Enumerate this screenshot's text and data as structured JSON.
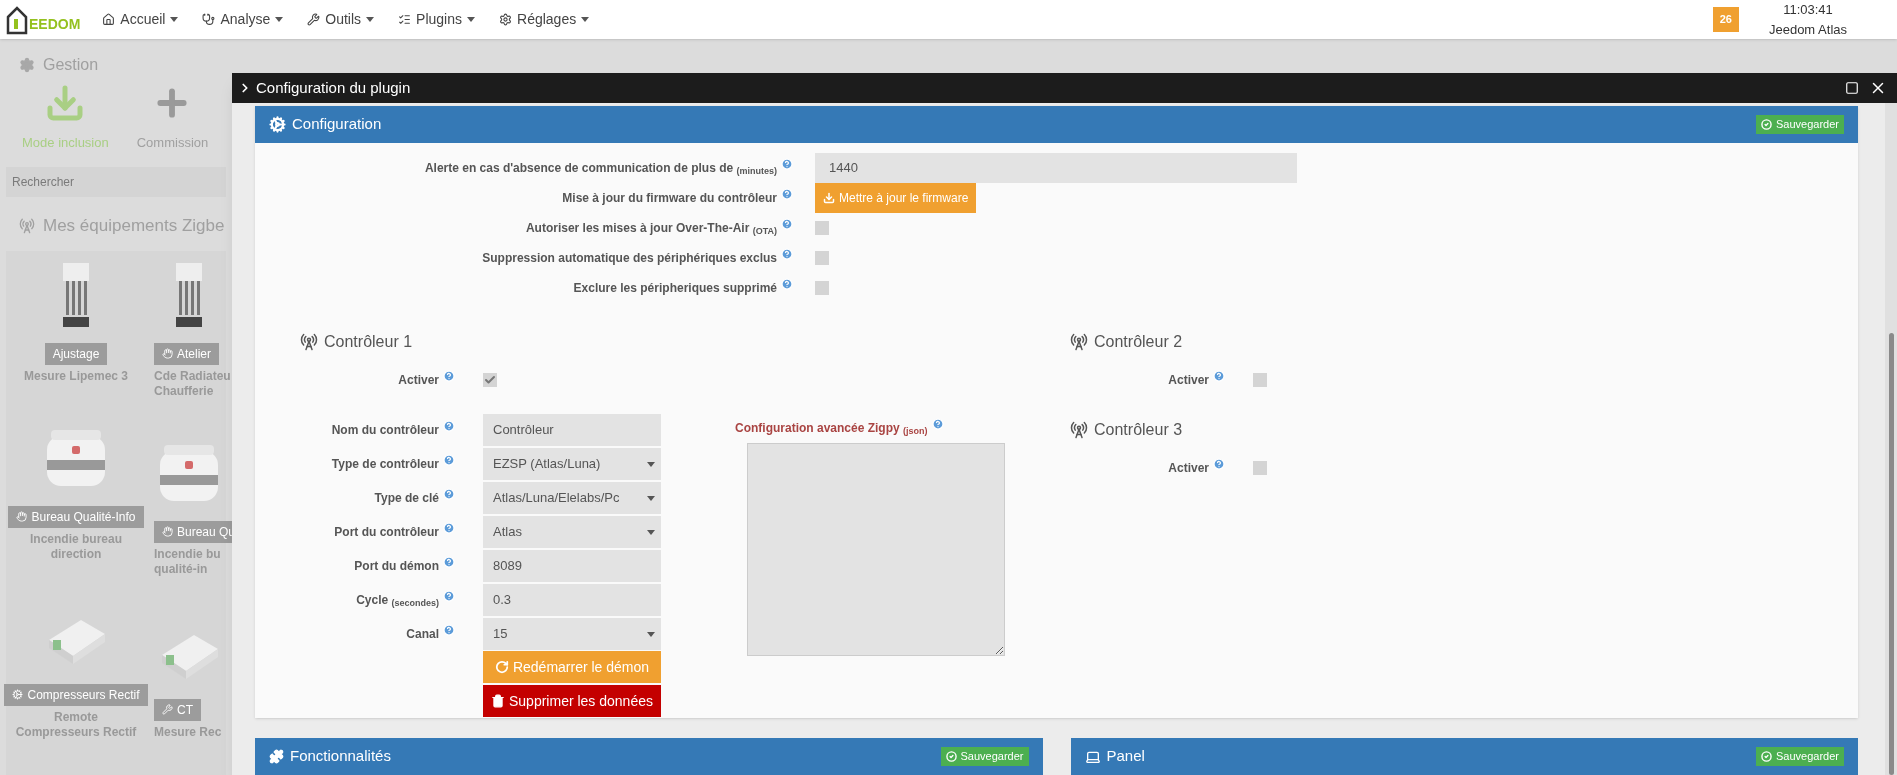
{
  "navbar": {
    "logo": "EEDOM",
    "menus": [
      {
        "label": "Accueil",
        "kind": "home"
      },
      {
        "label": "Analyse",
        "kind": "stethoscope"
      },
      {
        "label": "Outils",
        "kind": "wrench"
      },
      {
        "label": "Plugins",
        "kind": "list"
      },
      {
        "label": "Réglages",
        "kind": "cog"
      }
    ],
    "badge": "26",
    "time": "11:03:41",
    "user": "Jeedom Atlas"
  },
  "background": {
    "section_title": "Gestion",
    "actions": [
      {
        "label": "Mode inclusion",
        "kind": "download"
      },
      {
        "label": "Commission",
        "kind": "plus"
      }
    ],
    "search": {
      "placeholder": "Rechercher"
    },
    "devices_title": "Mes équipements Zigbe",
    "devices": [
      {
        "tag": "Ajustage",
        "kind": "plain",
        "name_lines": [
          "Mesure Lipemec 3"
        ]
      },
      {
        "tag": "Atelier",
        "kind": "hand",
        "name_lines": [
          "Cde Radiateu",
          "Chaufferie"
        ]
      },
      {
        "tag": "Bureau Qualité-Info",
        "kind": "hand",
        "name_lines": [
          "Incendie bureau",
          "direction"
        ]
      },
      {
        "tag": "Bureau Qu",
        "kind": "hand",
        "name_lines": [
          "Incendie bu",
          "qualité-in"
        ]
      },
      {
        "tag": "Compresseurs Rectif",
        "kind": "gears",
        "name_lines": [
          "Remote",
          "Compresseurs Rectif"
        ]
      },
      {
        "tag": "CT",
        "kind": "tools",
        "name_lines": [
          "Mesure Rec"
        ]
      }
    ]
  },
  "modal": {
    "title": "Configuration du plugin",
    "panel": {
      "title": "Configuration",
      "save": "Sauvegarder",
      "rows": [
        {
          "label": "Alerte en cas d'absence de communication de plus de $_{(minutes)}$",
          "kind": "input",
          "value": "1440"
        },
        {
          "label": "Mise à jour du firmware du contrôleur",
          "kind": "button",
          "button": "Mettre à jour le firmware"
        },
        {
          "label": "Autoriser les mises à jour Over-The-Air $_{(OTA)}$",
          "kind": "checkbox",
          "checked": false
        },
        {
          "label": "Suppression automatique des périphériques exclus",
          "kind": "checkbox",
          "checked": false
        },
        {
          "label": "Exclure les péripheriques supprimé",
          "kind": "checkbox",
          "checked": false
        }
      ],
      "controllers": [
        {
          "title": "Contrôleur 1",
          "activate": {
            "label": "Activer",
            "checked": true
          },
          "fields": [
            {
              "label": "Nom du contrôleur",
              "kind": "input",
              "value": "Contrôleur"
            },
            {
              "label": "Type de contrôleur",
              "kind": "select",
              "value": "EZSP (Atlas/Luna)"
            },
            {
              "label": "Type de clé",
              "kind": "select",
              "value": "Atlas/Luna/Elelabs/Pc"
            },
            {
              "label": "Port du contrôleur",
              "kind": "select",
              "value": "Atlas"
            },
            {
              "label": "Port du démon",
              "kind": "input",
              "value": "8089"
            },
            {
              "label": "Cycle $_{(secondes)}$",
              "kind": "input",
              "value": "0.3"
            },
            {
              "label": "Canal",
              "kind": "select",
              "value": "15"
            }
          ],
          "buttons": [
            {
              "label": "Redémarrer le démon",
              "kind": "restart"
            },
            {
              "label": "Supprimer les données",
              "kind": "delete"
            }
          ],
          "advanced": {
            "label": "Configuration avancée Zigpy $_{(json)}$"
          }
        },
        {
          "title": "Contrôleur 2",
          "activate": {
            "label": "Activer",
            "checked": false
          }
        },
        {
          "title": "Contrôleur 3",
          "activate": {
            "label": "Activer",
            "checked": false
          }
        }
      ]
    },
    "bottom_panels": [
      {
        "title": "Fonctionnalités",
        "kind": "puzzle",
        "save": "Sauvegarder"
      },
      {
        "title": "Panel",
        "kind": "laptop",
        "save": "Sauvegarder"
      }
    ]
  }
}
